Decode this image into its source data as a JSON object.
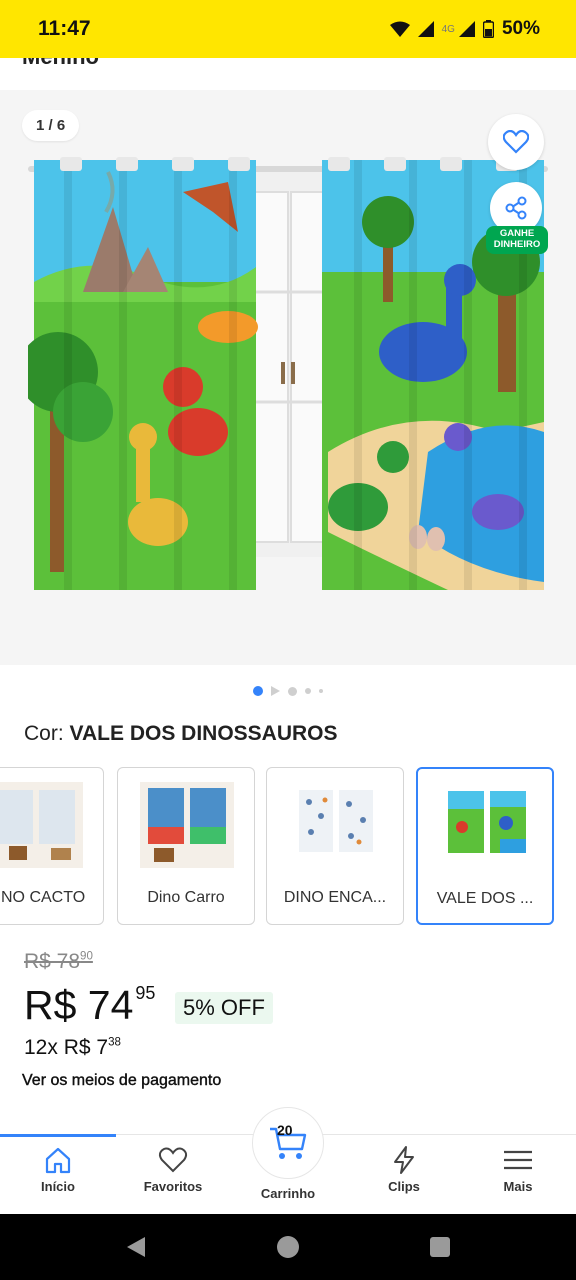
{
  "status_bar": {
    "time": "11:47",
    "network": "4G",
    "battery": "50%"
  },
  "header": {
    "cut_title": "Menino"
  },
  "gallery": {
    "counter": "1 / 6",
    "earn_badge_line1": "GANHE",
    "earn_badge_line2": "DINHEIRO",
    "icons": [
      "heart-icon",
      "share-icon"
    ],
    "page_total": 6,
    "page_current": 1
  },
  "color_selector": {
    "label": "Cor:",
    "value": "VALE DOS DINOSSAUROS",
    "variants": [
      {
        "label": "NO CACTO"
      },
      {
        "label": "Dino Carro"
      },
      {
        "label": "DINO ENCA..."
      },
      {
        "label": "VALE DOS ..."
      }
    ],
    "selected_index": 3
  },
  "pricing": {
    "old_price_main": "R$ 78",
    "old_price_cents": "90",
    "price_main": "R$ 74",
    "price_cents": "95",
    "discount": "5% OFF",
    "installments_main": "12x R$ 7",
    "installments_cents": "38",
    "payment_link": "Ver os meios de pagamento"
  },
  "bottom_nav": {
    "items": [
      {
        "label": "Início",
        "icon": "home-icon"
      },
      {
        "label": "Favoritos",
        "icon": "heart-icon"
      },
      {
        "label": "Carrinho",
        "icon": "cart-icon"
      },
      {
        "label": "Clips",
        "icon": "bolt-icon"
      },
      {
        "label": "Mais",
        "icon": "menu-icon"
      }
    ],
    "cart_count": "20",
    "active_index": 0
  },
  "colors": {
    "brand_yellow": "#ffe600",
    "accent_blue": "#3483fa",
    "earn_green": "#00a650"
  }
}
